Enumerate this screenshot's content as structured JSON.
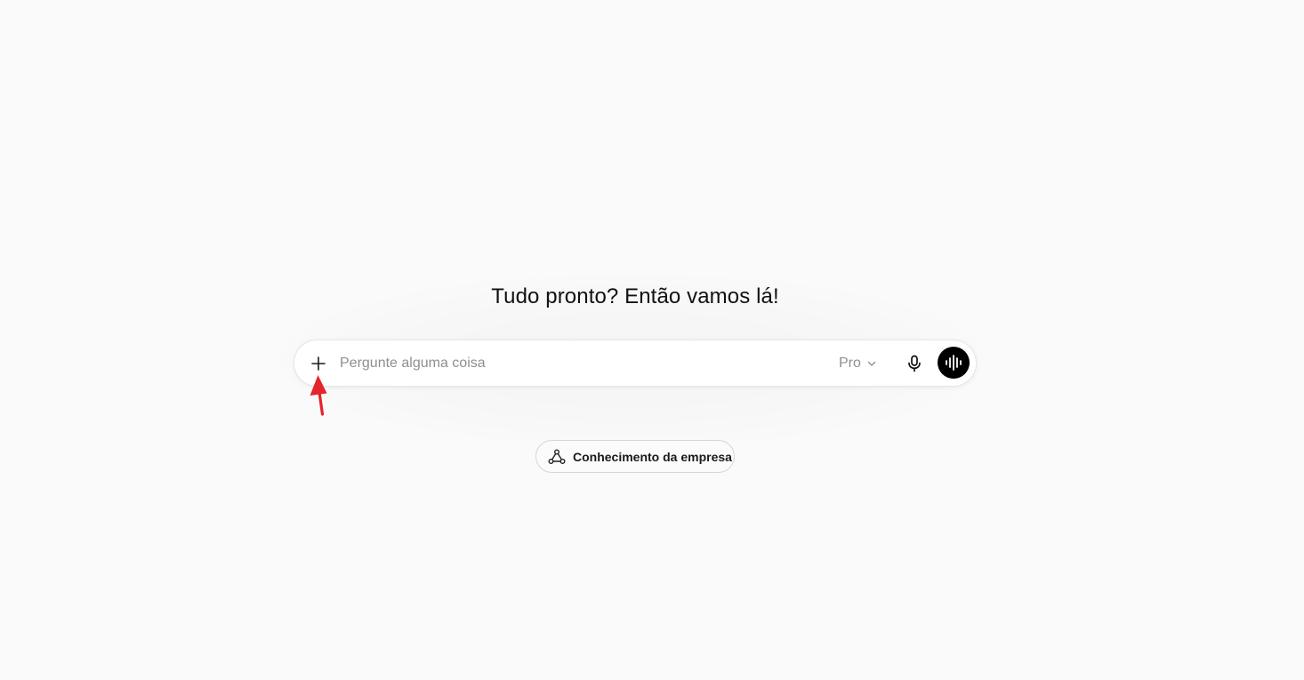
{
  "main": {
    "heading": "Tudo pronto? Então vamos lá!"
  },
  "composer": {
    "placeholder": "Pergunte alguma coisa",
    "model_label": "Pro",
    "add_icon": "plus-icon",
    "model_icon": "chevron-down-icon",
    "mic_icon": "microphone-icon",
    "voice_icon": "voice-waveform-icon"
  },
  "chips": [
    {
      "label": "Conhecimento da empresa",
      "icon": "company-knowledge-icon"
    }
  ],
  "annotation": {
    "arrow_color": "#e5242b"
  }
}
